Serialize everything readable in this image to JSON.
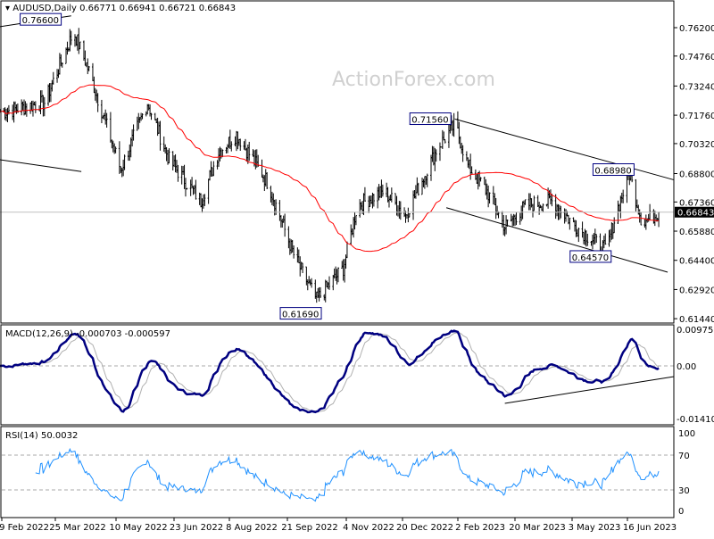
{
  "header": {
    "symbol": "AUDUSD,Daily",
    "ohlc": "0.66771 0.66941 0.66721 0.66843",
    "watermark": "ActionForex.com"
  },
  "colors": {
    "candle": "#000000",
    "moving_average": "#ff0000",
    "macd": "#000080",
    "signal": "#b0b0b0",
    "rsi": "#1e90ff",
    "current_price_box": "#000000"
  },
  "chart_data": [
    {
      "type": "candlestick",
      "title": "AUDUSD,Daily",
      "price_axis_ticks": [
        "0.76200",
        "0.74760",
        "0.73240",
        "0.71760",
        "0.70320",
        "0.68800",
        "0.67360",
        "0.65880",
        "0.64400",
        "0.62920",
        "0.61440"
      ],
      "date_axis_ticks": [
        "9 Feb 2022",
        "25 Mar 2022",
        "10 May 2022",
        "23 Jun 2022",
        "8 Aug 2022",
        "21 Sep 2022",
        "4 Nov 2022",
        "20 Dec 2022",
        "2 Feb 2023",
        "20 Mar 2023",
        "3 May 2023",
        "16 Jun 2023"
      ],
      "ylim": [
        0.613,
        0.773
      ],
      "current_price": "0.66843",
      "approx_closes": [
        [
          "2022-01-25",
          0.7195
        ],
        [
          "2022-02-25",
          0.724
        ],
        [
          "2022-03-20",
          0.76
        ],
        [
          "2022-04-01",
          0.74
        ],
        [
          "2022-04-26",
          0.69
        ],
        [
          "2022-05-17",
          0.724
        ],
        [
          "2022-06-03",
          0.695
        ],
        [
          "2022-06-28",
          0.674
        ],
        [
          "2022-07-12",
          0.699
        ],
        [
          "2022-07-26",
          0.708
        ],
        [
          "2022-08-20",
          0.683
        ],
        [
          "2022-09-10",
          0.645
        ],
        [
          "2022-09-27",
          0.624
        ],
        [
          "2022-10-18",
          0.64
        ],
        [
          "2022-10-29",
          0.672
        ],
        [
          "2022-11-19",
          0.679
        ],
        [
          "2022-12-06",
          0.667
        ],
        [
          "2022-12-31",
          0.701
        ],
        [
          "2023-01-14",
          0.713
        ],
        [
          "2023-01-24",
          0.692
        ],
        [
          "2023-02-08",
          0.679
        ],
        [
          "2023-02-22",
          0.661
        ],
        [
          "2023-03-11",
          0.672
        ],
        [
          "2023-04-01",
          0.674
        ],
        [
          "2023-04-19",
          0.661
        ],
        [
          "2023-05-13",
          0.649
        ],
        [
          "2023-05-20",
          0.667
        ],
        [
          "2023-05-31",
          0.688
        ],
        [
          "2023-06-10",
          0.663
        ],
        [
          "2023-06-24",
          0.66843
        ]
      ],
      "annotations": [
        {
          "label": "0.76600",
          "date": "2022-03-13",
          "price": 0.766
        },
        {
          "label": "0.71560",
          "date": "2023-01-12",
          "price": 0.7156
        },
        {
          "label": "0.68980",
          "date": "2023-06-05",
          "price": 0.6898
        },
        {
          "label": "0.64570",
          "date": "2023-05-18",
          "price": 0.6457
        },
        {
          "label": "0.61690",
          "date": "2022-09-30",
          "price": 0.6169
        }
      ],
      "trendlines": [
        {
          "from": [
            "2022-01-21",
            0.7625
          ],
          "to": [
            "2022-03-18",
            0.768
          ]
        },
        {
          "from": [
            "2022-01-21",
            0.695
          ],
          "to": [
            "2022-03-26",
            0.689
          ]
        },
        {
          "from": [
            "2023-01-14",
            0.7156
          ],
          "to": [
            "2023-07-05",
            0.6848
          ]
        },
        {
          "from": [
            "2023-01-07",
            0.6707
          ],
          "to": [
            "2023-06-30",
            0.638
          ]
        }
      ],
      "moving_average_period": 55
    },
    {
      "type": "line",
      "title": "MACD(12,26,9) -0.000703 -0.000597",
      "axis_ticks": [
        "0.009751",
        "0.00",
        "-0.014107"
      ],
      "ylim": [
        -0.0155,
        0.0112
      ],
      "series": [
        {
          "name": "MACD"
        },
        {
          "name": "Signal"
        }
      ],
      "trendline": {
        "from": [
          "2023-02-22",
          -0.01005
        ],
        "to": [
          "2023-07-05",
          -0.00287
        ]
      }
    },
    {
      "type": "line",
      "title": "RSI(14) 50.0032",
      "axis_ticks": [
        "100",
        "70",
        "30",
        "0"
      ],
      "ylim": [
        0,
        100
      ],
      "levels": [
        70,
        30
      ]
    }
  ]
}
